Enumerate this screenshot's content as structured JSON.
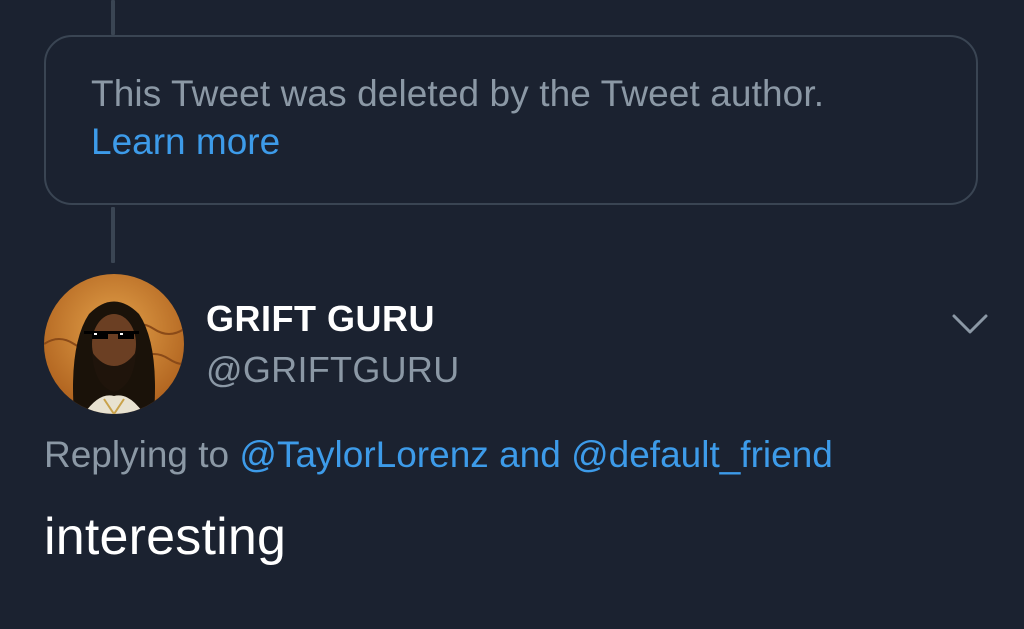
{
  "deleted_notice": {
    "message": "This Tweet was deleted by the Tweet author.",
    "link_label": "Learn more"
  },
  "tweet": {
    "display_name": "GRIFT GURU",
    "handle": "@GRIFTGURU",
    "replying_prefix": "Replying to",
    "mention_1": "@TaylorLorenz",
    "conjunction": "and",
    "mention_2": "@default_friend",
    "text": "interesting"
  },
  "icons": {
    "more": "chevron-down-icon",
    "avatar": "avatar-image"
  },
  "colors": {
    "background": "#1b2230",
    "border": "#3a4553",
    "muted_text": "#8b98a5",
    "link": "#3d9be9",
    "primary_text": "#ffffff"
  }
}
